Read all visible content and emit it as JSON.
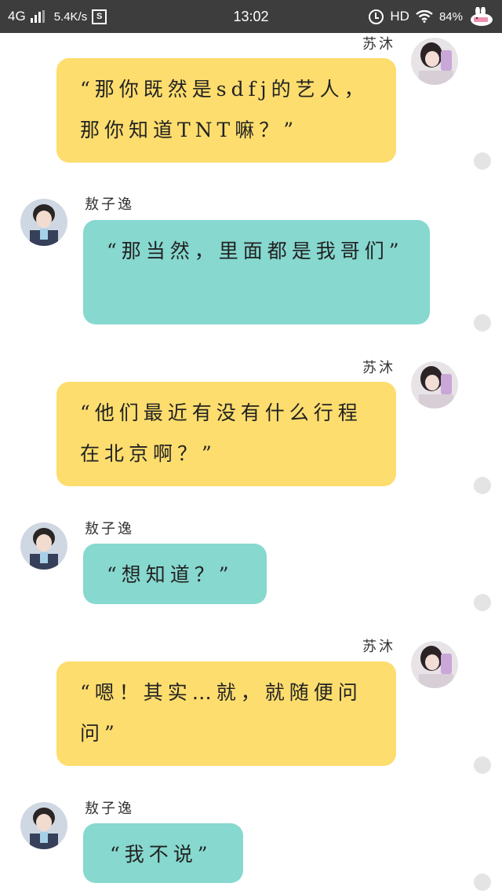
{
  "status_bar": {
    "network": "4G",
    "speed": "5.4K/s",
    "s_badge": "S",
    "time": "13:02",
    "hd": "HD",
    "battery": "84%"
  },
  "contacts": {
    "me": "苏沐",
    "other": "敖子逸"
  },
  "messages": [
    {
      "sender": "苏沐",
      "side": "right",
      "color": "#fddd6e",
      "text": "“那你既然是sdfj的艺人，那你知道TNT嘛？”"
    },
    {
      "sender": "敖子逸",
      "side": "left",
      "color": "#87d8cf",
      "text": "“那当然，里面都是我哥们”"
    },
    {
      "sender": "苏沐",
      "side": "right",
      "color": "#fddd6e",
      "text": "“他们最近有没有什么行程在北京啊？”"
    },
    {
      "sender": "敖子逸",
      "side": "left",
      "color": "#87d8cf",
      "text": "“想知道？”"
    },
    {
      "sender": "苏沐",
      "side": "right",
      "color": "#fddd6e",
      "text": "“嗯！其实…就，就随便问问”"
    },
    {
      "sender": "敖子逸",
      "side": "left",
      "color": "#87d8cf",
      "text": "“我不说”"
    }
  ]
}
